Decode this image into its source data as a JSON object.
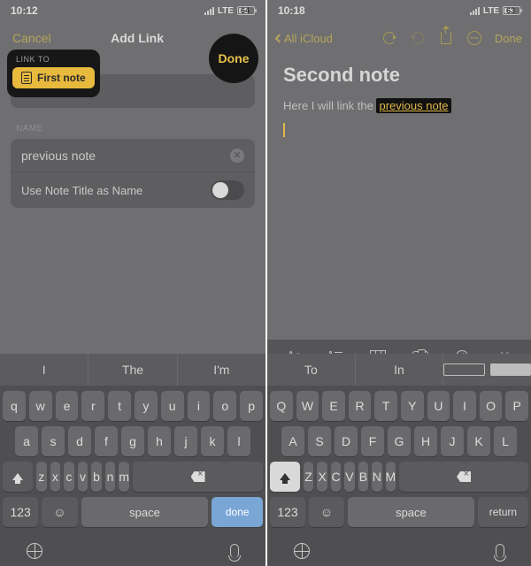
{
  "left": {
    "status": {
      "time": "10:12",
      "net": "LTE",
      "batt": "64"
    },
    "nav": {
      "cancel": "Cancel",
      "title": "Add Link",
      "done": "Done"
    },
    "linkto": {
      "label": "LINK TO",
      "chip": "First note"
    },
    "name": {
      "label": "NAME",
      "value": "previous note",
      "toggle": "Use Note Title as Name"
    },
    "sugg": [
      "I",
      "The",
      "I'm"
    ],
    "kb": {
      "r1": [
        "q",
        "w",
        "e",
        "r",
        "t",
        "y",
        "u",
        "i",
        "o",
        "p"
      ],
      "r2": [
        "a",
        "s",
        "d",
        "f",
        "g",
        "h",
        "j",
        "k",
        "l"
      ],
      "r3": [
        "z",
        "x",
        "c",
        "v",
        "b",
        "n",
        "m"
      ],
      "num": "123",
      "space": "space",
      "ret": "done"
    }
  },
  "right": {
    "status": {
      "time": "10:18",
      "net": "LTE",
      "batt": "63"
    },
    "nav": {
      "back": "All iCloud",
      "done": "Done"
    },
    "note": {
      "title": "Second note",
      "pre": "Here I will link the ",
      "link": "previous note"
    },
    "sugg": [
      "To",
      "In"
    ],
    "fmt": {
      "aa": "Aa"
    },
    "kb": {
      "r1": [
        "Q",
        "W",
        "E",
        "R",
        "T",
        "Y",
        "U",
        "I",
        "O",
        "P"
      ],
      "r2": [
        "A",
        "S",
        "D",
        "F",
        "G",
        "H",
        "J",
        "K",
        "L"
      ],
      "r3": [
        "Z",
        "X",
        "C",
        "V",
        "B",
        "N",
        "M"
      ],
      "num": "123",
      "space": "space",
      "ret": "return"
    }
  }
}
